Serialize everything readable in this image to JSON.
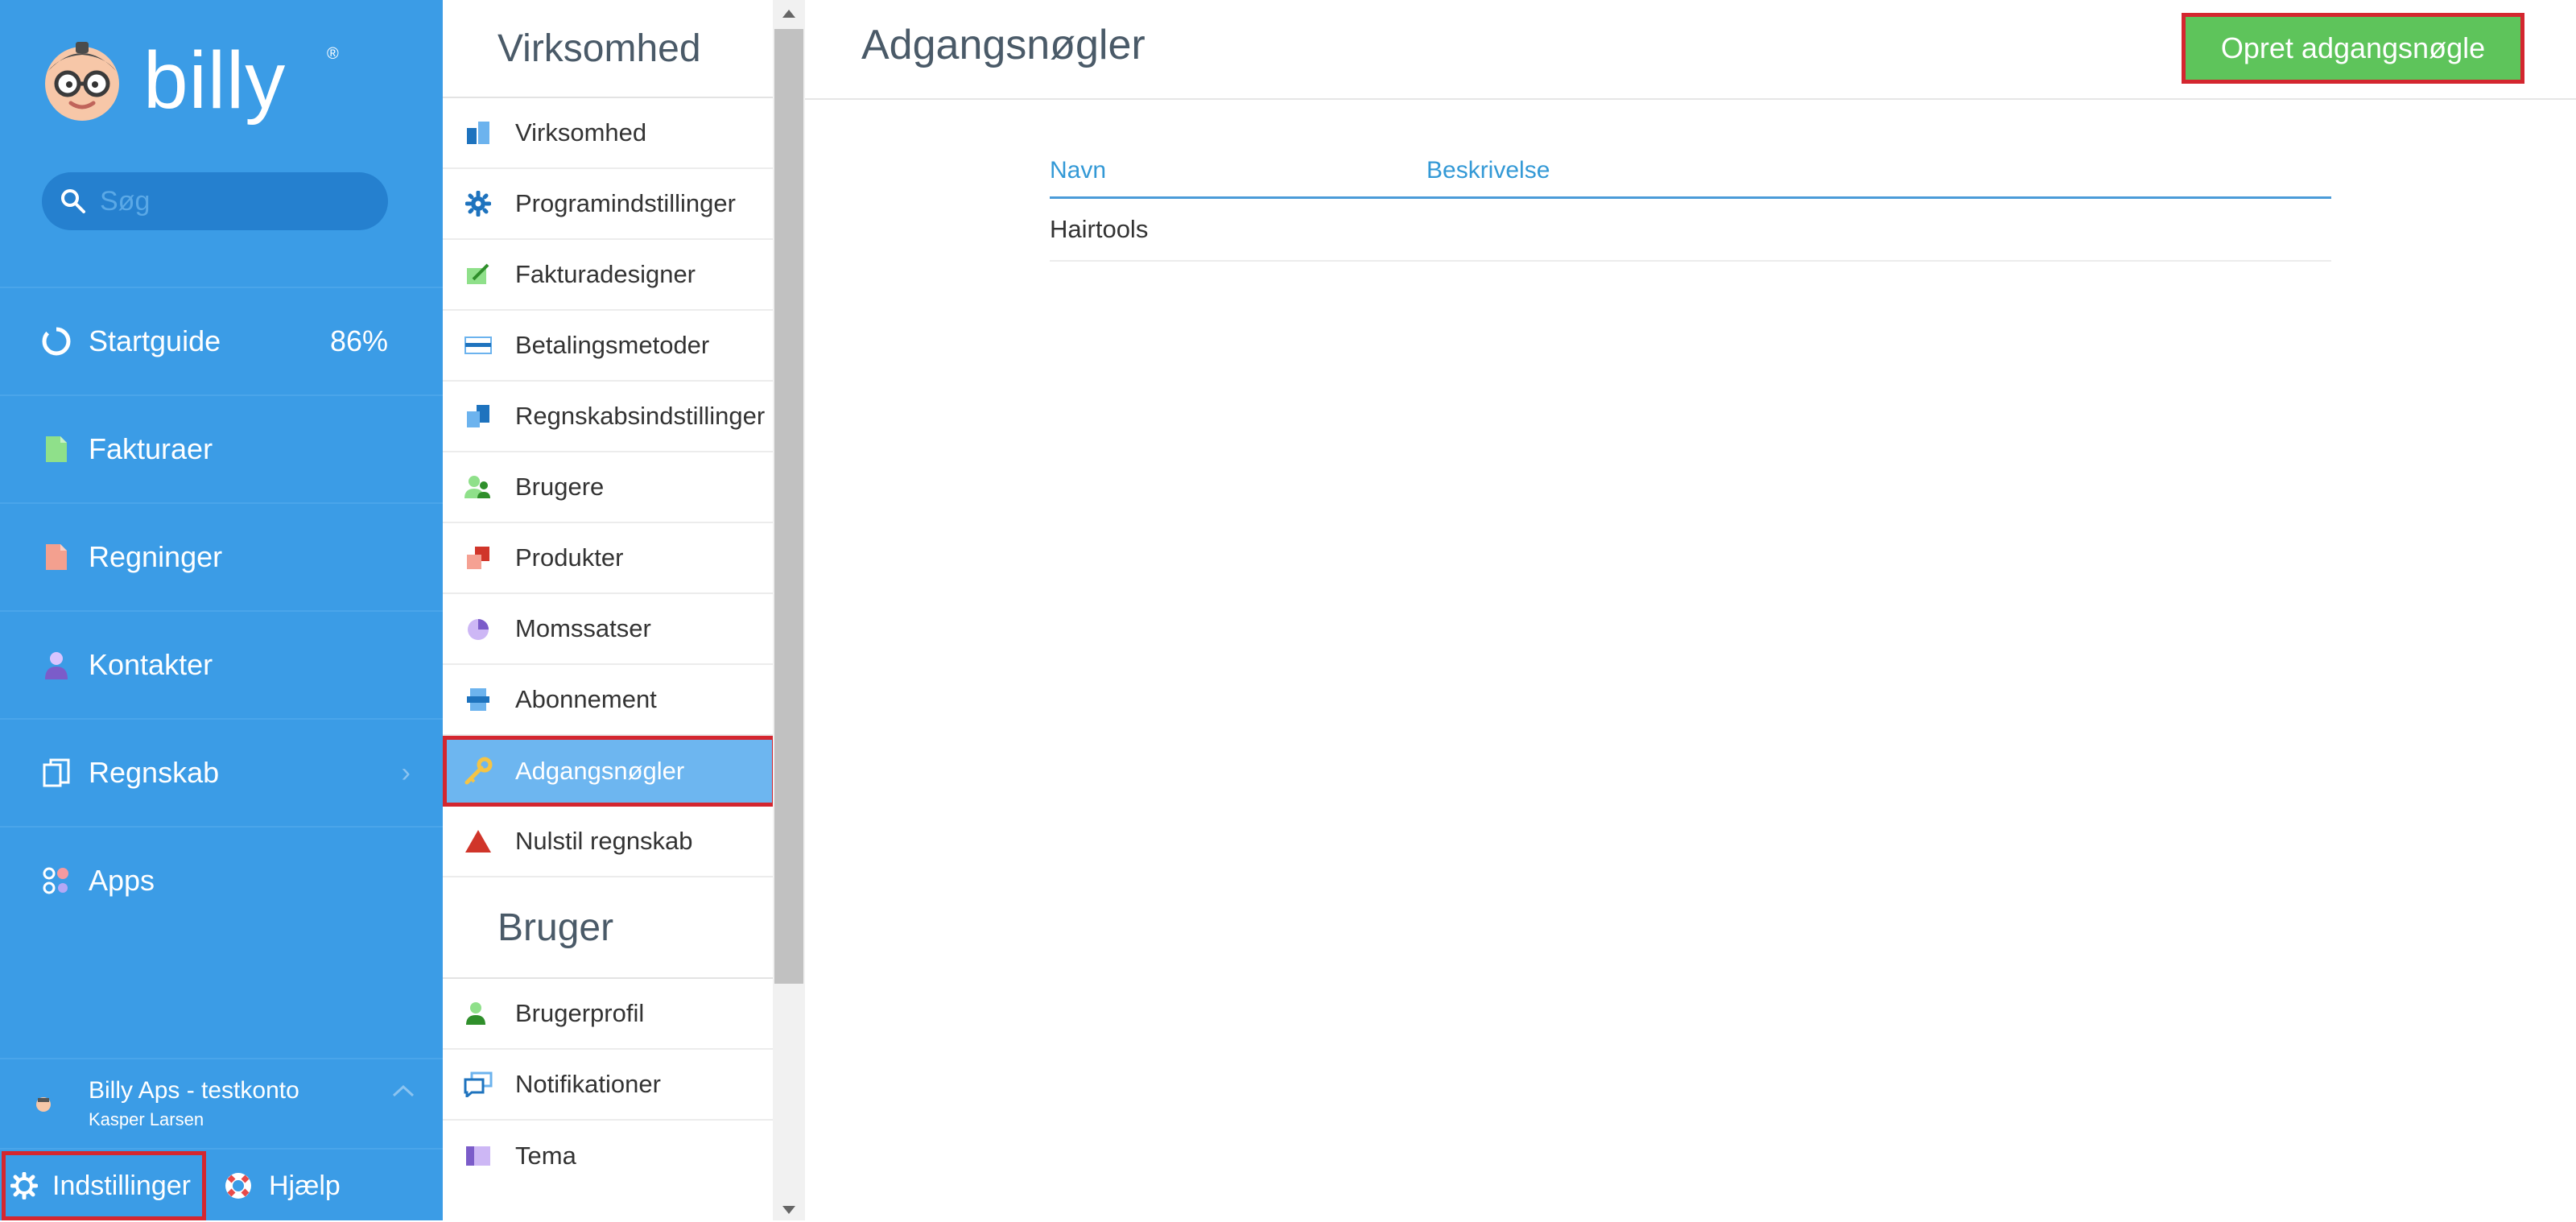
{
  "brand": {
    "name": "billy",
    "reg": "®"
  },
  "search": {
    "placeholder": "Søg"
  },
  "nav": {
    "items": [
      {
        "label": "Startguide",
        "badge": "86%",
        "icon": "progress-ring-icon"
      },
      {
        "label": "Fakturaer",
        "icon": "document-green-icon"
      },
      {
        "label": "Regninger",
        "icon": "document-red-icon"
      },
      {
        "label": "Kontakter",
        "icon": "person-icon"
      },
      {
        "label": "Regnskab",
        "icon": "ledger-icon",
        "chevron": "›"
      },
      {
        "label": "Apps",
        "icon": "apps-icon"
      }
    ]
  },
  "account": {
    "company": "Billy Aps - testkonto",
    "user": "Kasper Larsen"
  },
  "bottom": {
    "settings": "Indstillinger",
    "help": "Hjælp"
  },
  "settings": {
    "company_title": "Virksomhed",
    "company_items": [
      {
        "label": "Virksomhed",
        "icon": "building-icon"
      },
      {
        "label": "Programindstillinger",
        "icon": "gear-icon"
      },
      {
        "label": "Fakturadesigner",
        "icon": "design-icon"
      },
      {
        "label": "Betalingsmetoder",
        "icon": "card-icon"
      },
      {
        "label": "Regnskabsindstillinger",
        "icon": "ledger-icon"
      },
      {
        "label": "Brugere",
        "icon": "users-icon"
      },
      {
        "label": "Produkter",
        "icon": "products-icon"
      },
      {
        "label": "Momssatser",
        "icon": "pie-icon"
      },
      {
        "label": "Abonnement",
        "icon": "subscription-icon"
      },
      {
        "label": "Adgangsnøgler",
        "icon": "key-icon",
        "active": true
      },
      {
        "label": "Nulstil regnskab",
        "icon": "warning-icon"
      }
    ],
    "user_title": "Bruger",
    "user_items": [
      {
        "label": "Brugerprofil",
        "icon": "user-profile-icon"
      },
      {
        "label": "Notifikationer",
        "icon": "chat-icon"
      },
      {
        "label": "Tema",
        "icon": "theme-icon"
      }
    ]
  },
  "main": {
    "title": "Adgangsnøgler",
    "create_button": "Opret adgangsnøgle",
    "columns": [
      "Navn",
      "Beskrivelse"
    ],
    "rows": [
      {
        "name": "Hairtools",
        "description": ""
      }
    ]
  },
  "colors": {
    "sidebar": "#3b9ce6",
    "accent_green": "#5ec45b",
    "highlight_red": "#d4262f",
    "link_blue": "#3399d6",
    "active_item": "#6db6f0"
  }
}
